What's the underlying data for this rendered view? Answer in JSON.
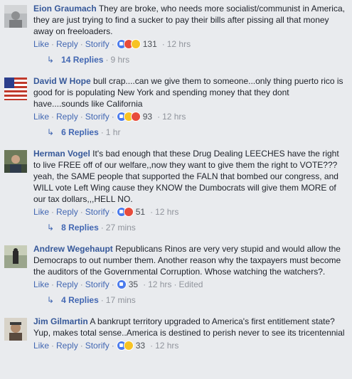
{
  "comments": [
    {
      "author": "Eion Graumach",
      "text": "They are broke, who needs more socialist/communist in America, they are just trying to find a sucker to pay their bills after pissing all that money away on freeloaders.",
      "like": "Like",
      "reply": "Reply",
      "storify": "Storify",
      "reactions": [
        "like",
        "angry",
        "haha"
      ],
      "count": "131",
      "time": "12 hrs",
      "replies": "14 Replies",
      "replies_time": "9 hrs"
    },
    {
      "author": "David W Hope",
      "text": "bull crap....can we give them to someone...only thing puerto rico is good for is populating New York and spending money that they dont have....sounds like California",
      "like": "Like",
      "reply": "Reply",
      "storify": "Storify",
      "reactions": [
        "like",
        "haha",
        "angry"
      ],
      "count": "93",
      "time": "12 hrs",
      "replies": "6 Replies",
      "replies_time": "1 hr"
    },
    {
      "author": "Herman Vogel",
      "text": "It's bad enough that these Drug Dealing LEECHES have the right to live FREE off of our welfare,,now they want to give them the right to VOTE??? yeah, the SAME people that supported the FALN that bombed our congress, and WILL vote Left Wing cause they KNOW the Dumbocrats will give them MORE of our tax dollars,,,HELL NO.",
      "like": "Like",
      "reply": "Reply",
      "storify": "Storify",
      "reactions": [
        "like",
        "angry"
      ],
      "count": "51",
      "time": "12 hrs",
      "replies": "8 Replies",
      "replies_time": "27 mins"
    },
    {
      "author": "Andrew Wegehaupt",
      "text": "Republicans Rinos are very very stupid and would allow the Democraps to out number them. Another reason why the taxpayers must become the auditors of the Governmental Corruption. Whose watching the watchers?.",
      "like": "Like",
      "reply": "Reply",
      "storify": "Storify",
      "reactions": [
        "like"
      ],
      "count": "35",
      "time": "12 hrs",
      "edited": "Edited",
      "replies": "4 Replies",
      "replies_time": "17 mins"
    },
    {
      "author": "Jim Gilmartin",
      "text": "A bankrupt territory upgraded to America's first entitlement state? Yup, makes total sense..America is destined to perish never to see its tricentennial",
      "like": "Like",
      "reply": "Reply",
      "storify": "Storify",
      "reactions": [
        "like",
        "sad"
      ],
      "count": "33",
      "time": "12 hrs"
    }
  ]
}
